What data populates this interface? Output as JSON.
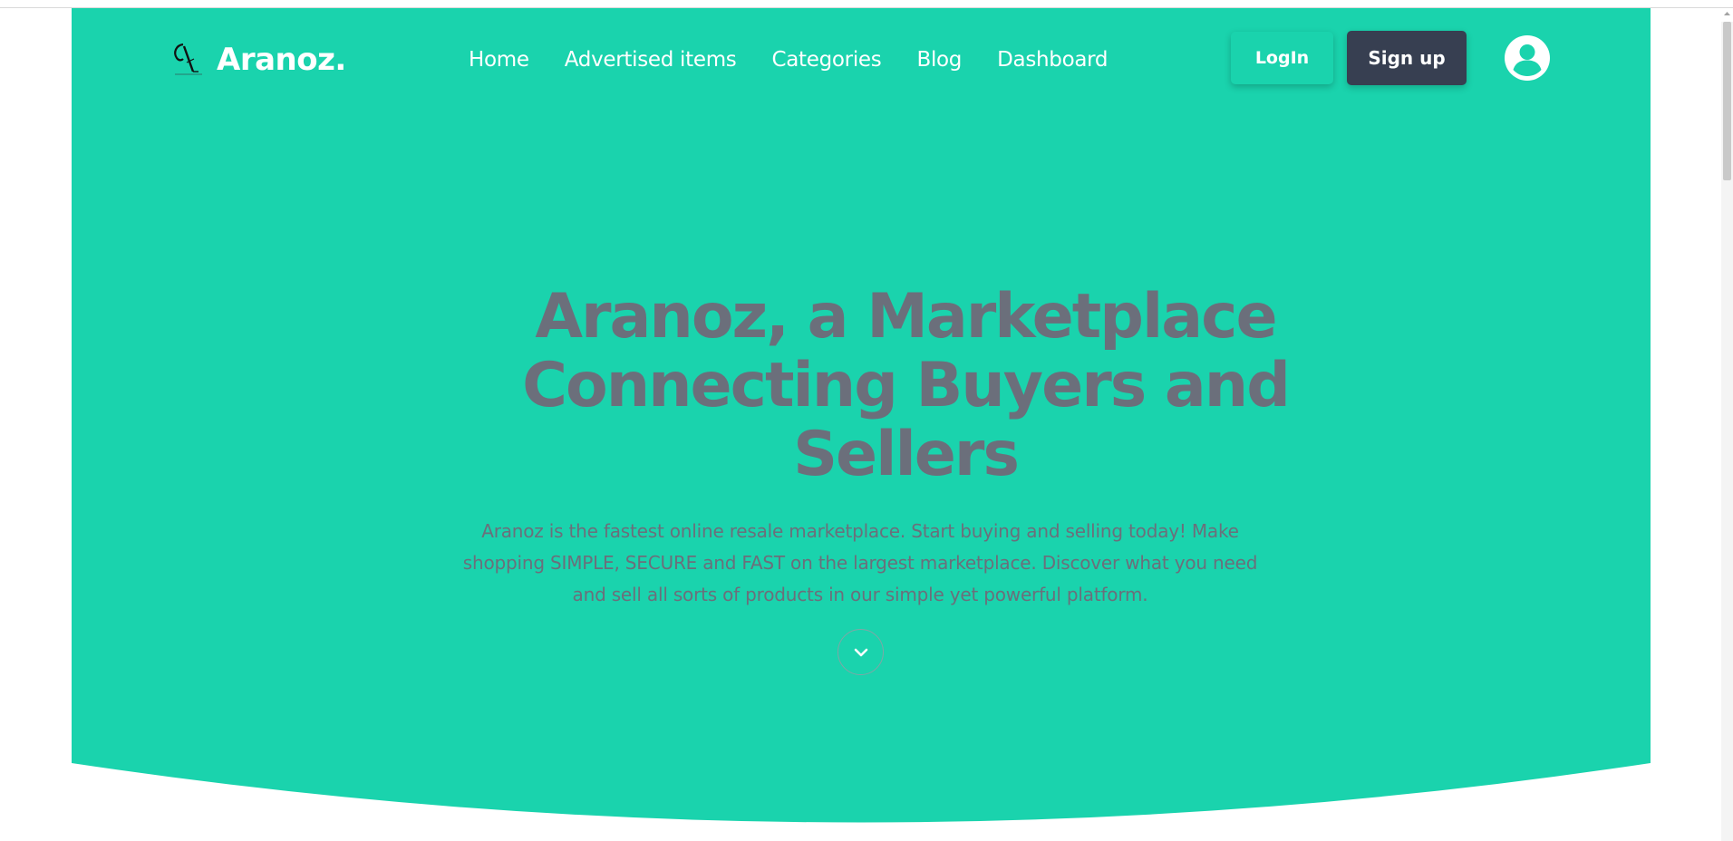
{
  "brand": {
    "name": "Aranoz."
  },
  "nav": {
    "links": [
      "Home",
      "Advertised items",
      "Categories",
      "Blog",
      "Dashboard"
    ],
    "login_label": "LogIn",
    "signup_label": "Sign up"
  },
  "hero": {
    "title": "Aranoz, a Marketplace Connecting Buyers and Sellers",
    "description": "Aranoz is the fastest online resale marketplace. Start buying and selling today! Make shopping SIMPLE, SECURE and FAST on the largest marketplace. Discover what you need and sell all sorts of products in our simple yet powerful platform."
  },
  "icons": {
    "logo": "aranoz-logo-icon",
    "user": "user-avatar-icon",
    "scroll": "chevron-down-icon"
  },
  "colors": {
    "primary": "#1ad3ad",
    "dark_button": "#373f51",
    "hero_text": "#6b6f7b",
    "white": "#ffffff"
  }
}
